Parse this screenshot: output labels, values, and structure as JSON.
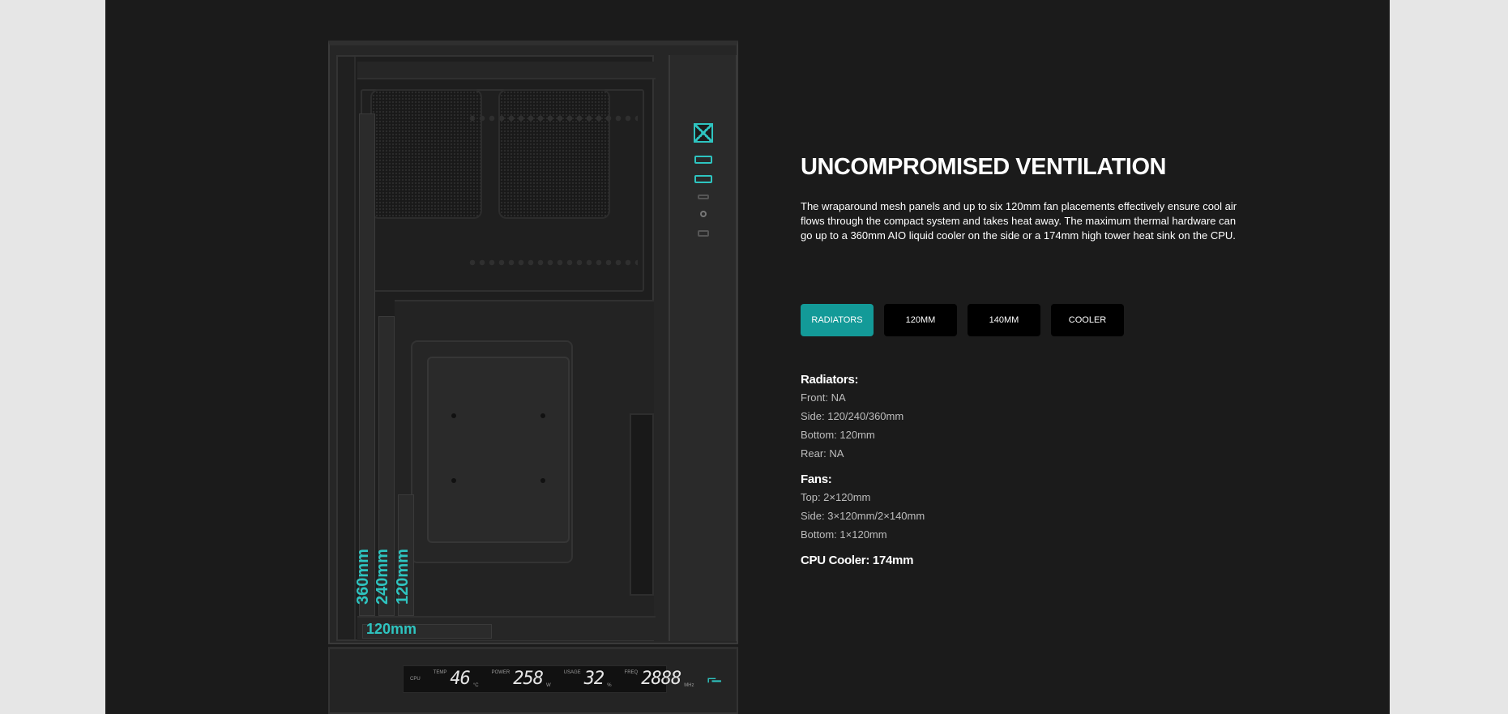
{
  "theme": {
    "background": "#1b1b1b",
    "page_edge": "#e6e6e6",
    "accent": "#139a98",
    "label_accent": "#2ec4c0",
    "tab_bg": "#000000"
  },
  "illustration": {
    "labels": {
      "rad_360": "360mm",
      "rad_240": "240mm",
      "rad_120_side": "120mm",
      "rad_120_bottom": "120mm"
    },
    "lcd": {
      "cpu_key": "CPU",
      "temp_key": "TEMP",
      "temp_val": "46",
      "temp_unit": "°C",
      "power_key": "POWER",
      "power_val": "258",
      "power_unit": "W",
      "usage_key": "USAGE",
      "usage_val": "32",
      "usage_unit": "%",
      "freq_key": "FREQ",
      "freq_val": "2888",
      "freq_unit": "MHz",
      "logo": "⌐̶"
    }
  },
  "content": {
    "title": "UNCOMPROMISED VENTILATION",
    "description": "The wraparound mesh panels and up to six 120mm fan placements effectively ensure cool air flows through the compact system and takes heat away. The maximum thermal hardware can go up to a 360mm AIO liquid cooler on the side or a 174mm high tower heat sink on the CPU.",
    "tabs": [
      {
        "label": "RADIATORS",
        "active": true
      },
      {
        "label": "120MM",
        "active": false
      },
      {
        "label": "140MM",
        "active": false
      },
      {
        "label": "COOLER",
        "active": false
      }
    ],
    "specs": {
      "radiators": {
        "heading": "Radiators:",
        "lines": [
          "Front: NA",
          "Side: 120/240/360mm",
          "Bottom: 120mm",
          "Rear: NA"
        ]
      },
      "fans": {
        "heading": "Fans:",
        "lines": [
          "Top: 2×120mm",
          "Side: 3×120mm/2×140mm",
          "Bottom: 1×120mm"
        ]
      },
      "cpu_cooler": {
        "heading": "CPU Cooler: 174mm"
      }
    }
  }
}
